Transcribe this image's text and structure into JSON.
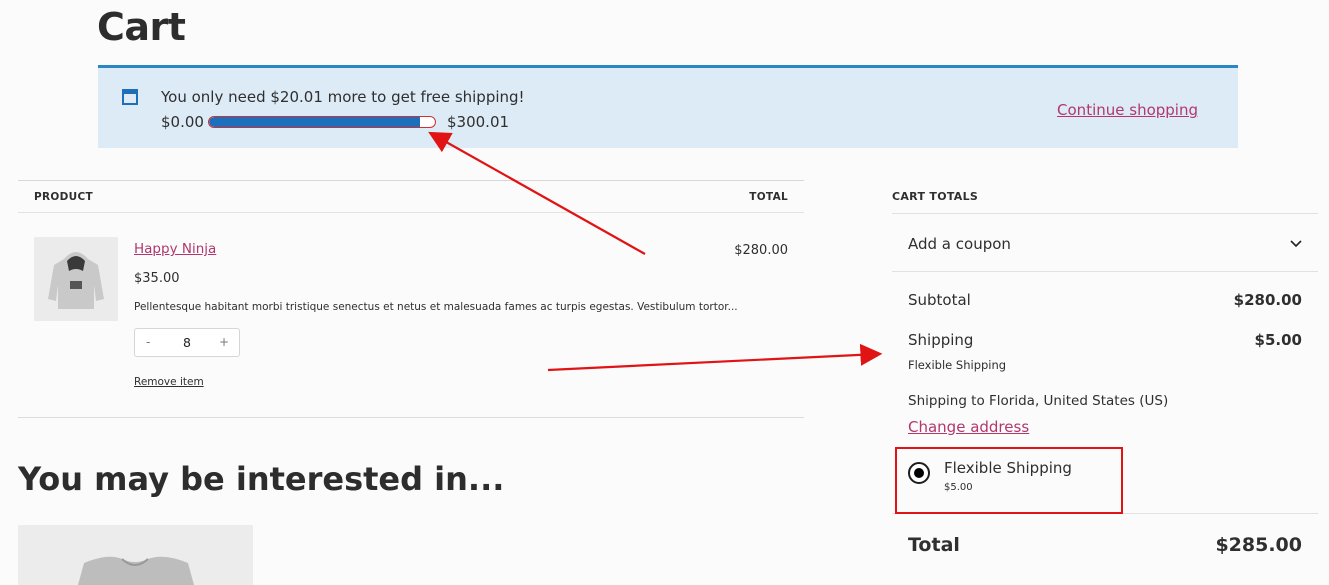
{
  "page": {
    "title": "Cart"
  },
  "notice": {
    "message": "You only need $20.01 more to get free shipping!",
    "progress_min": "$0.00",
    "progress_max": "$300.01",
    "progress_fraction": 0.933,
    "continue_label": "Continue shopping",
    "icon": "window-icon"
  },
  "table": {
    "headers": {
      "product": "PRODUCT",
      "total": "TOTAL"
    },
    "items": [
      {
        "name": "Happy Ninja",
        "price": "$35.00",
        "description": "Pellentesque habitant morbi tristique senectus et netus et malesuada fames ac turpis egestas. Vestibulum tortor...",
        "quantity": "8",
        "minus": "-",
        "plus": "+",
        "remove_label": "Remove item",
        "line_total": "$280.00"
      }
    ]
  },
  "interest": {
    "title": "You may be interested in..."
  },
  "totals": {
    "heading": "CART TOTALS",
    "coupon_label": "Add a coupon",
    "subtotal_label": "Subtotal",
    "subtotal_value": "$280.00",
    "shipping_label": "Shipping",
    "shipping_value": "$5.00",
    "shipping_method": "Flexible Shipping",
    "shipping_destination": "Shipping to Florida, United States (US)",
    "change_address": "Change address",
    "option_label": "Flexible Shipping",
    "option_price": "$5.00",
    "total_label": "Total",
    "total_value": "$285.00"
  },
  "colors": {
    "accent_link": "#b2376d",
    "notice_bg": "#ddebf6",
    "notice_border": "#2a86c4",
    "progress_fill": "#1c6fbd",
    "annotation_red": "#e01414"
  }
}
